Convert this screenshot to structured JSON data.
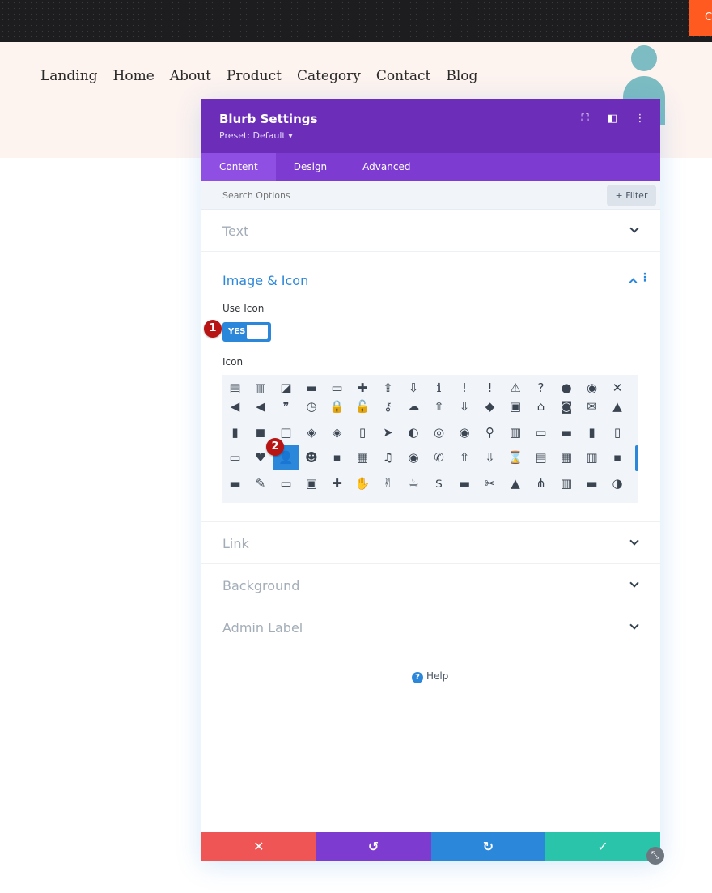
{
  "topbar": {
    "cta_label": "C"
  },
  "nav": {
    "items": [
      "Landing",
      "Home",
      "About",
      "Product",
      "Category",
      "Contact",
      "Blog"
    ]
  },
  "panel": {
    "title": "Blurb Settings",
    "preset": "Preset: Default ▾",
    "head_icons": [
      "fullscreen-icon",
      "split-view-icon",
      "more-options-icon"
    ],
    "tabs": [
      "Content",
      "Design",
      "Advanced"
    ],
    "active_tab": "Content",
    "search_placeholder": "Search Options",
    "filter_label": "+ Filter",
    "sections_top": [
      "Text"
    ],
    "image_section": {
      "title": "Image & Icon",
      "use_icon_label": "Use Icon",
      "toggle_label": "YES",
      "icon_label": "Icon",
      "selected_icon": "user-icon"
    },
    "sections_bottom": [
      "Link",
      "Background",
      "Admin Label"
    ],
    "help_label": "Help",
    "footer_buttons": [
      "cancel",
      "undo",
      "redo",
      "save"
    ]
  },
  "badges": [
    "1",
    "2"
  ],
  "colors": {
    "header_purple": "#6c2eb9",
    "tabs_purple": "#7d3bd1",
    "accent_blue": "#2b87da",
    "cancel_red": "#ef5555",
    "undo_purple": "#7e3bd0",
    "redo_blue": "#2b87da",
    "save_green": "#29c4a9",
    "badge_red": "#b81414"
  },
  "icon_glyphs": [
    [
      "▤",
      "▥",
      "◪",
      "▬",
      "▭",
      "✚",
      "⇪",
      "⇩",
      "ℹ",
      "!",
      "!",
      "⚠",
      "?",
      "●",
      "◉",
      "✕"
    ],
    [
      "◀",
      "◀",
      "❞",
      "◷",
      "🔒",
      "🔓",
      "⚷",
      "☁",
      "⇧",
      "⇩",
      "◆",
      "▣",
      "⌂",
      "◙",
      "✉",
      "▲"
    ],
    [
      "▮",
      "◼",
      "◫",
      "◈",
      "◈",
      "▯",
      "➤",
      "◐",
      "◎",
      "◉",
      "⚲",
      "▥",
      "▭",
      "▬",
      "▮",
      "▯"
    ],
    [
      "▭",
      "♥",
      "⚇",
      "☻",
      "▪",
      "▦",
      "♫",
      "◉",
      "✆",
      "⇧",
      "⇩",
      "⌛",
      "▤",
      "▦",
      "▥",
      "▪"
    ],
    [
      "▬",
      "✎",
      "▭",
      "▣",
      "✚",
      "✋",
      "✌",
      "☕",
      "$",
      "▬",
      "✂",
      "▲",
      "⋔",
      "▥",
      "▬",
      "◑"
    ]
  ]
}
